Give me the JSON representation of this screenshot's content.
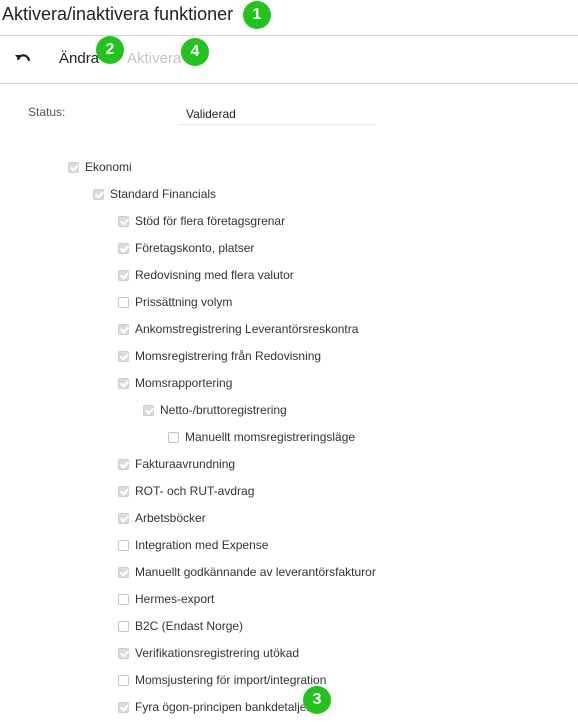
{
  "page": {
    "title": "Aktivera/inaktivera funktioner"
  },
  "toolbar": {
    "undo_icon": "undo-icon",
    "change_label": "Ändra",
    "activate_label": "Aktivera"
  },
  "badges": [
    "1",
    "2",
    "3",
    "4"
  ],
  "status": {
    "label": "Status:",
    "value": "Validerad"
  },
  "tree": [
    {
      "label": "Ekonomi",
      "checked": true
    },
    {
      "label": "Standard Financials",
      "checked": true
    },
    {
      "label": "Stöd för flera företagsgrenar",
      "checked": true
    },
    {
      "label": "Företagskonto, platser",
      "checked": true
    },
    {
      "label": "Redovisning med flera valutor",
      "checked": true
    },
    {
      "label": "Prissättning volym",
      "checked": false
    },
    {
      "label": "Ankomstregistrering Leverantörsreskontra",
      "checked": true
    },
    {
      "label": "Momsregistrering från Redovisning",
      "checked": true
    },
    {
      "label": "Momsrapportering",
      "checked": true
    },
    {
      "label": "Netto-/bruttoregistrering",
      "checked": true
    },
    {
      "label": "Manuellt momsregistreringsläge",
      "checked": false
    },
    {
      "label": "Fakturaavrundning",
      "checked": true
    },
    {
      "label": "ROT- och RUT-avdrag",
      "checked": true
    },
    {
      "label": "Arbetsböcker",
      "checked": true
    },
    {
      "label": "Integration med Expense",
      "checked": false
    },
    {
      "label": "Manuellt godkännande av leverantörsfakturor",
      "checked": true
    },
    {
      "label": "Hermes-export",
      "checked": false
    },
    {
      "label": "B2C (Endast Norge)",
      "checked": false
    },
    {
      "label": "Verifikationsregistrering utökad",
      "checked": true
    },
    {
      "label": "Momsjustering för import/integration",
      "checked": false
    },
    {
      "label": "Fyra ögon-principen bankdetaljer",
      "checked": true
    }
  ]
}
